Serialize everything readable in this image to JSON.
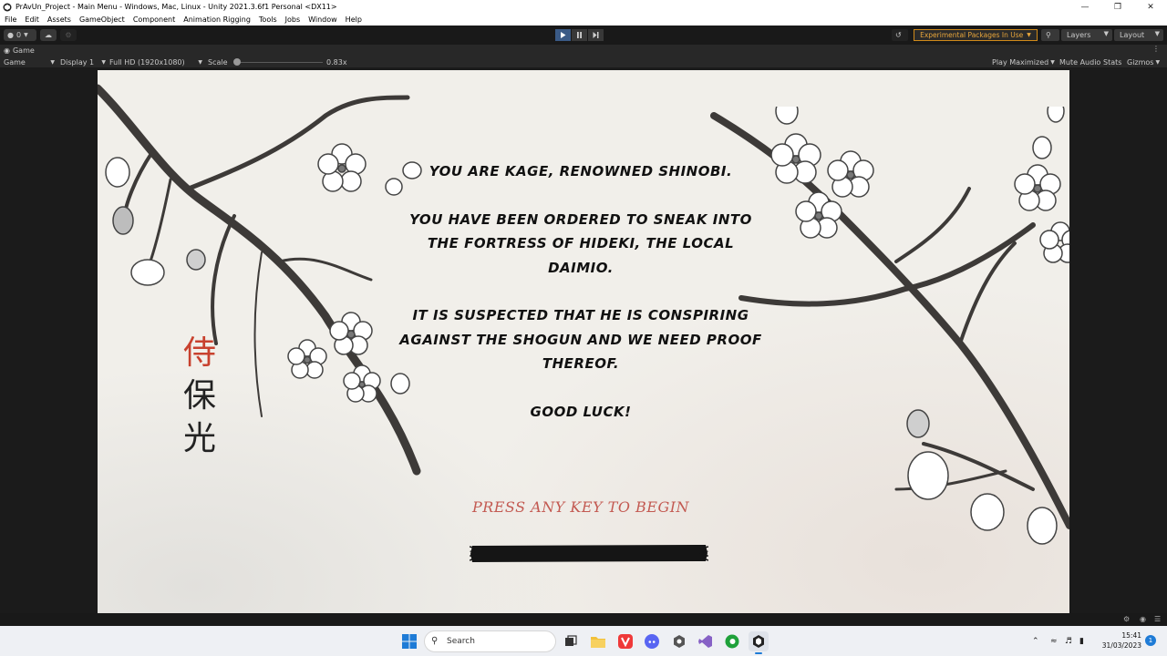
{
  "window": {
    "title": "PrAvUn_Project - Main Menu - Windows, Mac, Linux - Unity 2021.3.6f1 Personal <DX11>"
  },
  "menu": {
    "items": [
      "File",
      "Edit",
      "Assets",
      "GameObject",
      "Component",
      "Animation Rigging",
      "Tools",
      "Jobs",
      "Window",
      "Help"
    ]
  },
  "toolbar": {
    "account_label": "0",
    "experimental_label": "Experimental Packages In Use",
    "layers_label": "Layers",
    "layout_label": "Layout"
  },
  "game_view": {
    "tab_label": "Game",
    "mode_label": "Game",
    "display_label": "Display 1",
    "resolution_label": "Full HD (1920x1080)",
    "scale_label": "Scale",
    "scale_value": "0.83x",
    "scale_level": 0.02,
    "play_maximized_label": "Play Maximized",
    "mute_audio_label": "Mute Audio",
    "stats_label": "Stats",
    "gizmos_label": "Gizmos"
  },
  "game": {
    "story_paragraphs": [
      "YOU ARE KAGE, RENOWNED SHINOBI.",
      "YOU HAVE BEEN ORDERED TO SNEAK INTO THE FORTRESS OF HIDEKI, THE LOCAL DAIMIO.",
      "IT IS SUSPECTED THAT HE IS CONSPIRING AGAINST THE SHOGUN AND WE NEED PROOF THEREOF.",
      "GOOD LUCK!"
    ],
    "kanji": [
      "侍",
      "保",
      "光"
    ],
    "press_prompt": "PRESS ANY KEY TO BEGIN",
    "loading_progress": 0
  },
  "taskbar": {
    "search_placeholder": "Search",
    "time": "15:41",
    "date": "31/03/2023",
    "notification_count": "1"
  },
  "colors": {
    "accent_orange": "#e8a63b",
    "play_active": "#3a5a86",
    "kanji_red": "#c8412e",
    "prompt_red": "#c35a52"
  }
}
